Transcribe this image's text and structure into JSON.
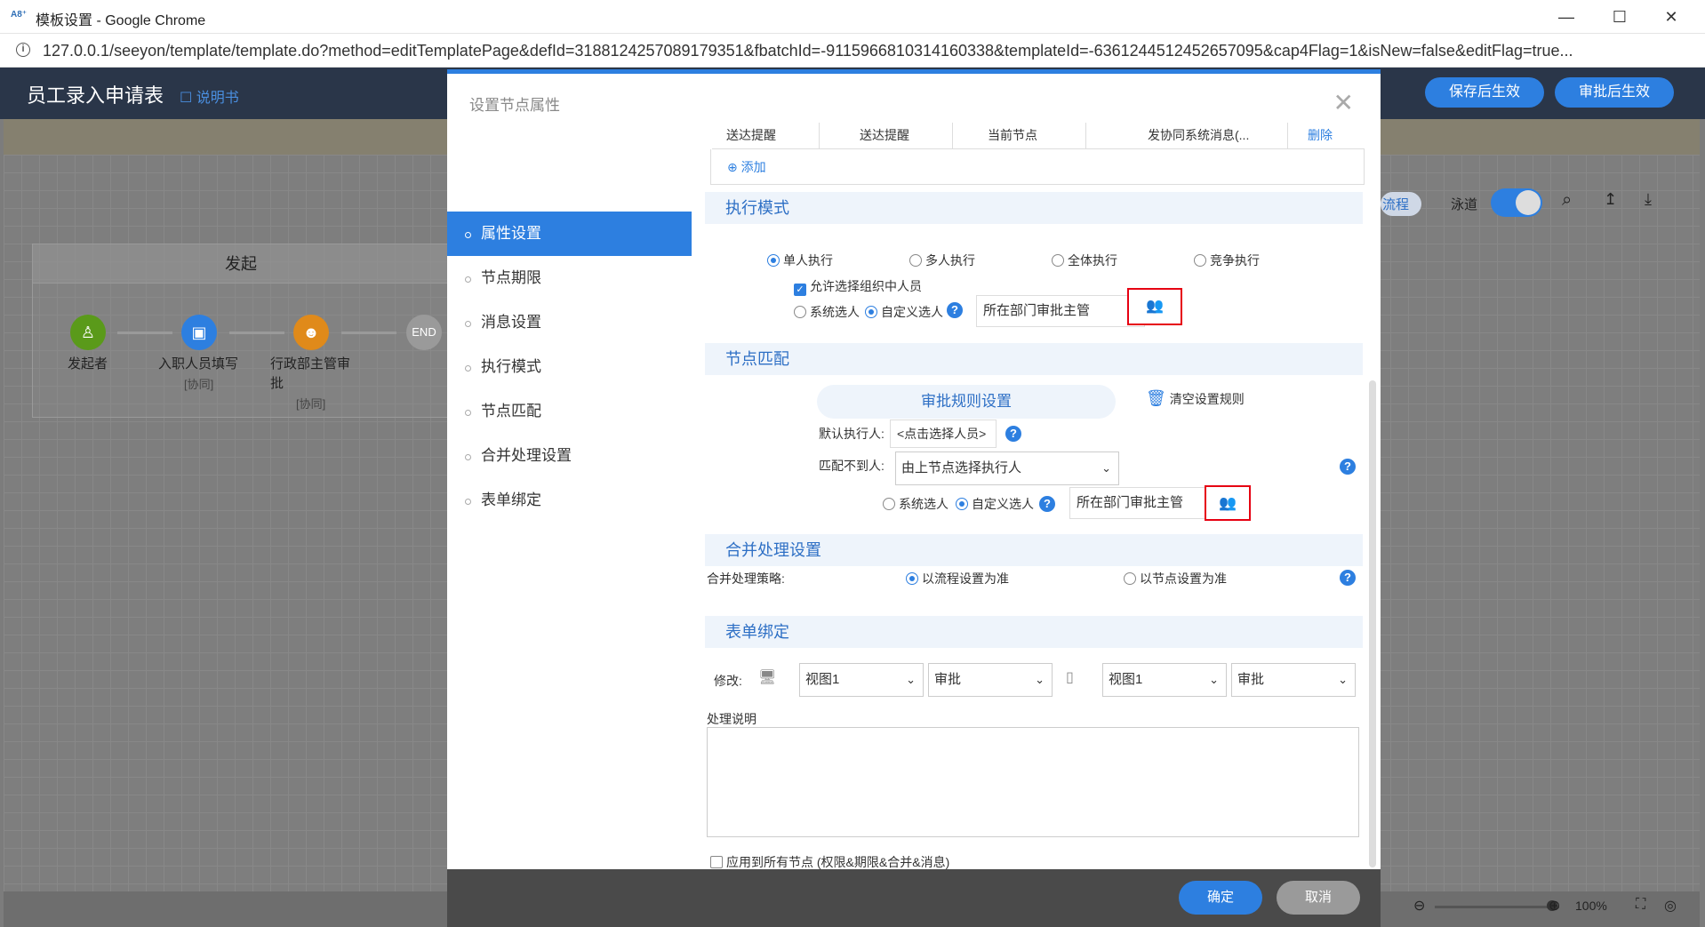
{
  "browser": {
    "title": "模板设置 - Google Chrome",
    "app_badge": "A8⁺",
    "url": "127.0.0.1/seeyon/template/template.do?method=editTemplatePage&defId=3188124257089179351&fbatchId=-9115966810314160338&templateId=-6361244512452657095&cap4Flag=1&isNew=false&editFlag=true..."
  },
  "app": {
    "title": "员工录入申请表",
    "manual": "说明书",
    "save_btn": "保存后生效",
    "approve_btn": "审批后生效"
  },
  "flow": {
    "lane_title": "发起",
    "nodes": [
      {
        "label": "发起者",
        "sub": ""
      },
      {
        "label": "入职人员填写",
        "sub": "[协同]"
      },
      {
        "label": "行政部主管审",
        "label2": "批",
        "sub": "[协同]"
      },
      {
        "label": "END",
        "sub": ""
      }
    ],
    "toolbar": {
      "flow_btn": "流程",
      "lane": "泳道",
      "zoom": "100%"
    }
  },
  "dialog": {
    "title": "设置节点属性",
    "nav": [
      "属性设置",
      "节点期限",
      "消息设置",
      "执行模式",
      "节点匹配",
      "合并处理设置",
      "表单绑定"
    ],
    "active_nav": "属性设置",
    "table_row": [
      "送达提醒",
      "送达提醒",
      "当前节点",
      "发协同系统消息(...",
      "删除"
    ],
    "add": "添加",
    "exec": {
      "section": "执行模式",
      "options": [
        "单人执行",
        "多人执行",
        "全体执行",
        "竞争执行"
      ],
      "selected": "单人执行",
      "allow_org": "允许选择组织中人员",
      "sys_pick": "系统选人",
      "custom_pick": "自定义选人",
      "person_value": "所在部门审批主管"
    },
    "match": {
      "section": "节点匹配",
      "rule_btn": "审批规则设置",
      "clear_rule": "清空设置规则",
      "default_label": "默认执行人:",
      "default_value": "<点击选择人员>",
      "nomatch_label": "匹配不到人:",
      "nomatch_value": "由上节点选择执行人",
      "sys_pick": "系统选人",
      "custom_pick": "自定义选人",
      "person_value": "所在部门审批主管"
    },
    "merge": {
      "section": "合并处理设置",
      "label": "合并处理策略:",
      "opt1": "以流程设置为准",
      "opt2": "以节点设置为准"
    },
    "form": {
      "section": "表单绑定",
      "modify_label": "修改:",
      "pc_view": "视图1",
      "pc_mode": "审批",
      "mobile_view": "视图1",
      "mobile_mode": "审批",
      "desc_label": "处理说明"
    },
    "apply_all": "应用到所有节点 (权限&期限&合并&消息)",
    "ok": "确定",
    "cancel": "取消"
  },
  "colors": {
    "accent": "#2d7fe0",
    "header": "#2a3649",
    "highlight": "#e60012"
  }
}
